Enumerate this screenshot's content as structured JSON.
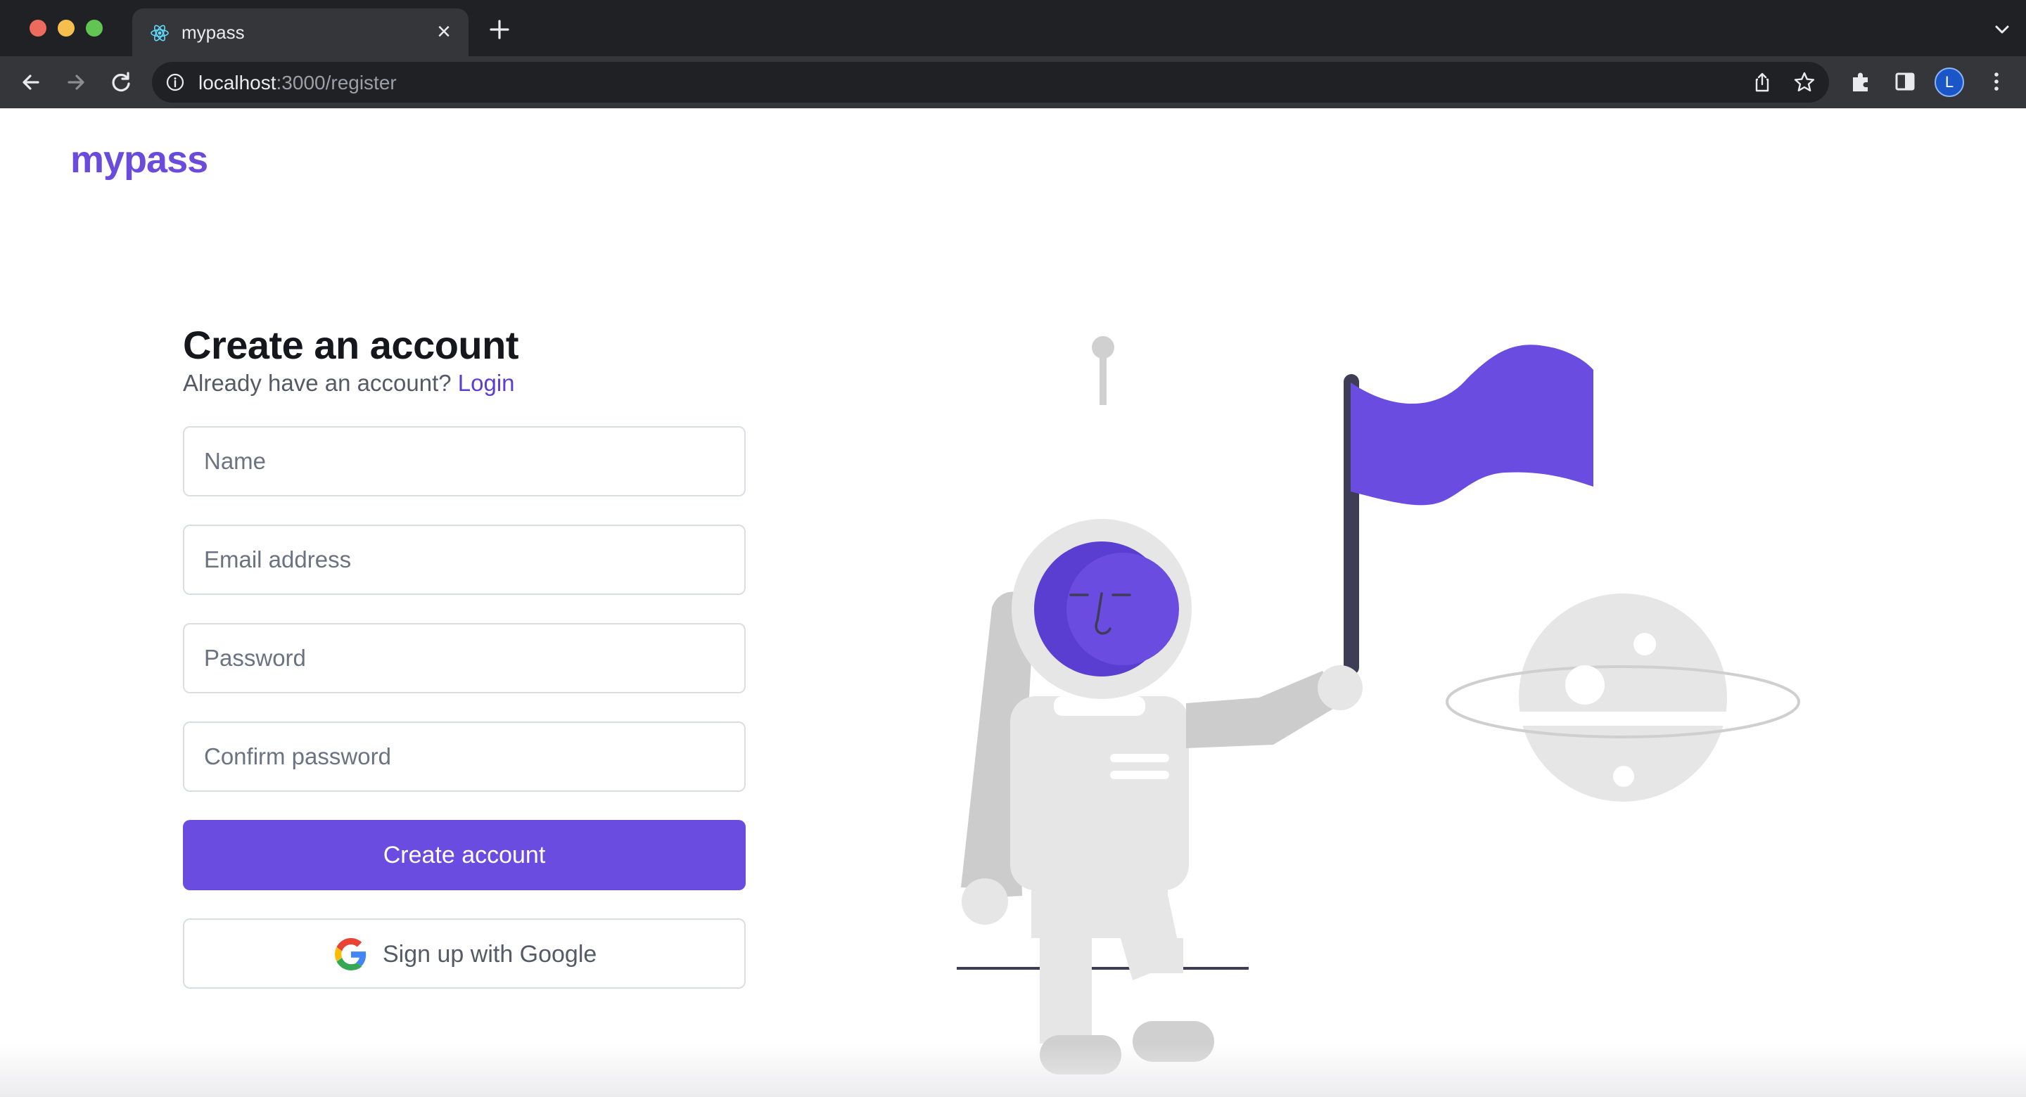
{
  "browser": {
    "tab_title": "mypass",
    "url_host": "localhost",
    "url_path": ":3000/register",
    "profile_initial": "L"
  },
  "page": {
    "logo": "mypass",
    "title": "Create an account",
    "subtitle_prefix": "Already have an account?",
    "login_link": "Login",
    "fields": {
      "name_placeholder": "Name",
      "email_placeholder": "Email address",
      "password_placeholder": "Password",
      "confirm_placeholder": "Confirm password"
    },
    "create_button": "Create account",
    "google_button": "Sign up with Google"
  },
  "colors": {
    "accent": "#6b4ce0",
    "logo": "#6a4bdb",
    "illustration_gray": "#e6e6e6",
    "illustration_dark": "#3f3d56"
  }
}
